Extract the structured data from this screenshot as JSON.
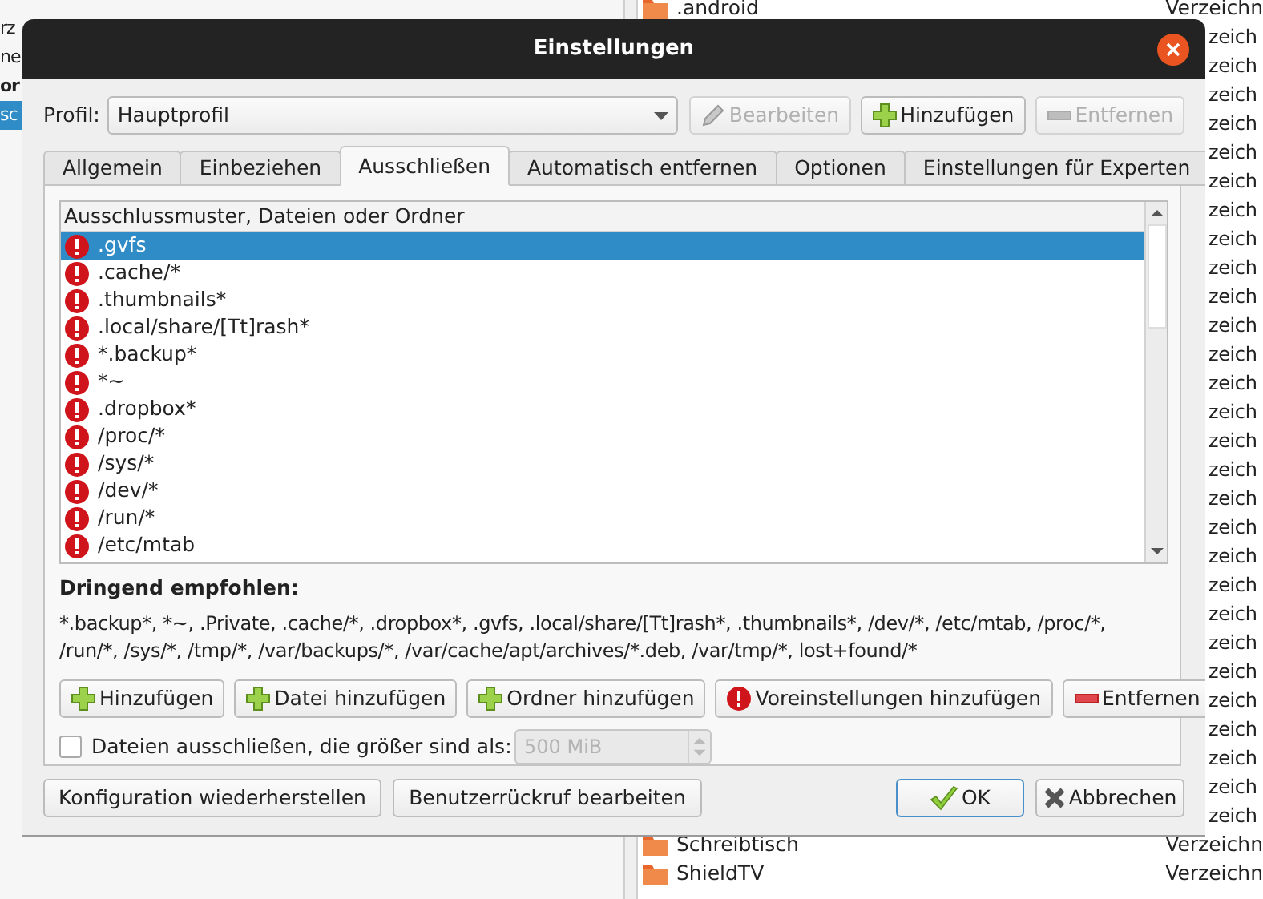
{
  "background": {
    "left_items": [
      {
        "text": "rz",
        "bold": false,
        "selected": false
      },
      {
        "text": "ne",
        "bold": false,
        "selected": false
      },
      {
        "text": "or",
        "bold": true,
        "selected": false
      },
      {
        "text": "sc",
        "bold": false,
        "selected": true
      }
    ],
    "files": [
      {
        "name": ".android",
        "type": "Verzeichn"
      },
      {
        "type": "zeich"
      },
      {
        "type": "zeich"
      },
      {
        "type": "zeich"
      },
      {
        "type": "zeich"
      },
      {
        "type": "zeich"
      },
      {
        "type": "zeich"
      },
      {
        "type": "zeich"
      },
      {
        "type": "zeich"
      },
      {
        "type": "zeich"
      },
      {
        "type": "zeich"
      },
      {
        "type": "zeich"
      },
      {
        "type": "zeich"
      },
      {
        "type": "zeich"
      },
      {
        "type": "zeich"
      },
      {
        "type": "zeich"
      },
      {
        "type": "zeich"
      },
      {
        "type": "zeich"
      },
      {
        "type": "zeich"
      },
      {
        "type": "zeich"
      },
      {
        "type": "zeich"
      },
      {
        "type": "zeich"
      },
      {
        "type": "zeich"
      },
      {
        "type": "zeich"
      },
      {
        "type": "zeich"
      },
      {
        "type": "zeich"
      },
      {
        "type": "zeich"
      },
      {
        "type": "zeich"
      },
      {
        "type": "zeich"
      },
      {
        "name": "Schreibtisch",
        "type": "Verzeichn"
      },
      {
        "name": "ShieldTV",
        "type": "Verzeichn"
      }
    ]
  },
  "dialog": {
    "title": "Einstellungen",
    "profile": {
      "label": "Profil:",
      "value": "Hauptprofil",
      "buttons": [
        {
          "label": "Bearbeiten",
          "kind": "edit",
          "disabled": true
        },
        {
          "label": "Hinzufügen",
          "kind": "add",
          "disabled": false
        },
        {
          "label": "Entfernen",
          "kind": "remove",
          "disabled": true
        }
      ]
    },
    "tabs": [
      {
        "label": "Allgemein",
        "selected": false
      },
      {
        "label": "Einbeziehen",
        "selected": false
      },
      {
        "label": "Ausschließen",
        "selected": true
      },
      {
        "label": "Automatisch entfernen",
        "selected": false
      },
      {
        "label": "Optionen",
        "selected": false
      },
      {
        "label": "Einstellungen für Experten",
        "selected": false
      }
    ],
    "list": {
      "header": "Ausschlussmuster, Dateien oder Ordner",
      "rows": [
        {
          "text": ".gvfs",
          "selected": true
        },
        {
          "text": ".cache/*",
          "selected": false
        },
        {
          "text": ".thumbnails*",
          "selected": false
        },
        {
          "text": ".local/share/[Tt]rash*",
          "selected": false
        },
        {
          "text": "*.backup*",
          "selected": false
        },
        {
          "text": "*~",
          "selected": false
        },
        {
          "text": ".dropbox*",
          "selected": false
        },
        {
          "text": "/proc/*",
          "selected": false
        },
        {
          "text": "/sys/*",
          "selected": false
        },
        {
          "text": "/dev/*",
          "selected": false
        },
        {
          "text": "/run/*",
          "selected": false
        },
        {
          "text": "/etc/mtab",
          "selected": false
        }
      ]
    },
    "recommended": {
      "heading": "Dringend empfohlen:",
      "text": "*.backup*, *~, .Private, .cache/*, .dropbox*, .gvfs, .local/share/[Tt]rash*, .thumbnails*, /dev/*, /etc/mtab, /proc/*, /run/*, /sys/*, /tmp/*, /var/backups/*, /var/cache/apt/archives/*.deb, /var/tmp/*, lost+found/*"
    },
    "list_buttons": [
      {
        "label": "Hinzufügen",
        "kind": "add"
      },
      {
        "label": "Datei hinzufügen",
        "kind": "add"
      },
      {
        "label": "Ordner hinzufügen",
        "kind": "add"
      },
      {
        "label": "Voreinstellungen hinzufügen",
        "kind": "defaults"
      },
      {
        "label": "Entfernen",
        "kind": "delete"
      }
    ],
    "size_limit": {
      "label": "Dateien ausschließen, die größer sind als:",
      "checked": false,
      "value": "500 MiB",
      "disabled": true
    },
    "footer_left": [
      "Konfiguration wiederherstellen",
      "Benutzerrückruf bearbeiten"
    ],
    "footer_right": [
      {
        "label": "OK",
        "kind": "confirm",
        "default": true
      },
      {
        "label": "Abbrechen",
        "kind": "cancel",
        "default": false
      }
    ]
  }
}
